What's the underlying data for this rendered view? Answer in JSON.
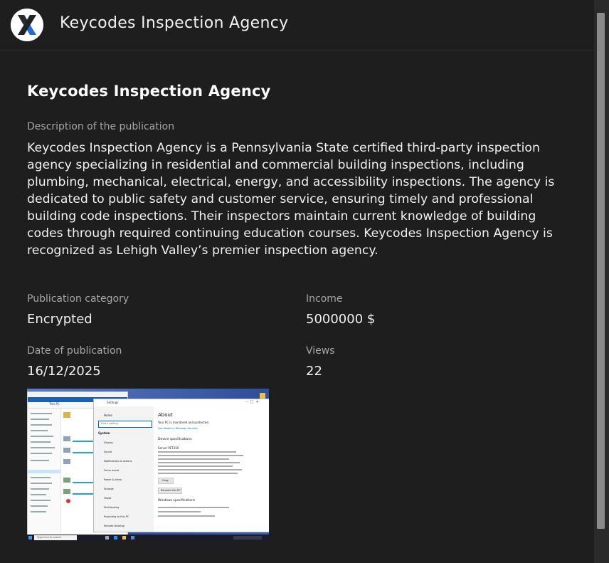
{
  "header": {
    "title": "Keycodes Inspection Agency",
    "logo_icon": "keycodes-x-logo-icon"
  },
  "publication": {
    "title": "Keycodes Inspection Agency",
    "description_label": "Description of the publication",
    "description": "Keycodes Inspection Agency is a Pennsylvania State certified third-party inspection agency specializing in residential and commercial building inspections, including plumbing, mechanical, electrical, energy, and accessibility inspections. The agency is dedicated to public safety and customer service, ensuring timely and professional building code inspections. Their inspectors maintain current knowledge of building codes through required continuing education courses. Keycodes Inspection Agency is recognized as Lehigh Valley’s premier inspection agency.",
    "category_label": "Publication category",
    "category_value": "Encrypted",
    "income_label": "Income",
    "income_value": "5000000 $",
    "date_label": "Date of publication",
    "date_value": "16/12/2025",
    "views_label": "Views",
    "views_value": "22"
  },
  "screenshot": {
    "settings_title": "Settings",
    "home": "Home",
    "search_placeholder": "Find a setting",
    "system_heading": "System",
    "menu": [
      "Display",
      "Sound",
      "Notifications & actions",
      "Focus assist",
      "Power & sleep",
      "Storage",
      "Tablet",
      "Multitasking",
      "Projecting to this PC",
      "Remote Desktop"
    ],
    "about_title": "About",
    "protected_text": "Your PC is monitored and protected.",
    "security_link": "See details in Windows Security",
    "device_spec_heading": "Device specifications",
    "device_name": "Server PET350",
    "copy_button": "Copy",
    "rename_button": "Rename this PC",
    "windows_spec_heading": "Windows specifications",
    "explorer_title": "This PC",
    "taskbar_search": "Type here to search",
    "colors": {
      "desktop": "#4a67b0",
      "taskbar": "#1b1b2a",
      "accent": "#0067c0"
    }
  }
}
